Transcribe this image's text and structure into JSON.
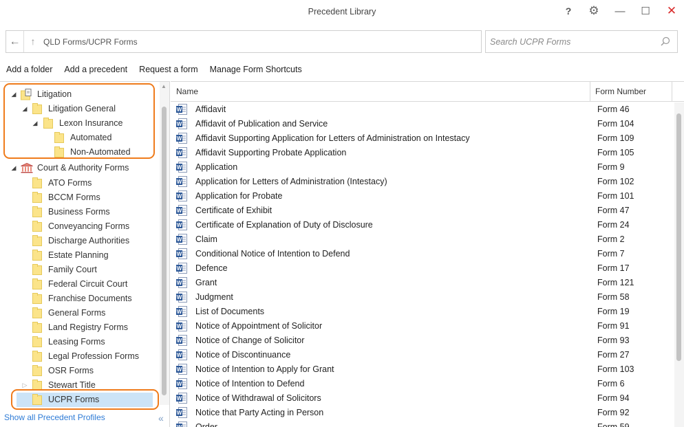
{
  "window": {
    "title": "Precedent Library",
    "help": "?",
    "gear": "⚙",
    "minimize": "—",
    "maximize": "☐",
    "close": "✕"
  },
  "address": {
    "back": "←",
    "up": "↑",
    "path": "QLD Forms/UCPR Forms"
  },
  "search": {
    "placeholder": "Search UCPR Forms"
  },
  "toolbar": {
    "add_folder": "Add a folder",
    "add_precedent": "Add a precedent",
    "request_form": "Request a form",
    "manage_shortcuts": "Manage Form Shortcuts"
  },
  "tree": {
    "litigation": "Litigation",
    "litigation_general": "Litigation General",
    "lexon_insurance": "Lexon Insurance",
    "automated": "Automated",
    "non_automated": "Non-Automated",
    "court_authority": "Court & Authority Forms",
    "folders": [
      "ATO Forms",
      "BCCM Forms",
      "Business Forms",
      "Conveyancing Forms",
      "Discharge Authorities",
      "Estate Planning",
      "Family Court",
      "Federal Circuit Court",
      "Franchise Documents",
      "General Forms",
      "Land Registry Forms",
      "Leasing Forms",
      "Legal Profession Forms",
      "OSR Forms",
      "Stewart Title",
      "UCPR Forms"
    ]
  },
  "left_footer": {
    "show_profiles": "Show all Precedent Profiles",
    "collapse": "«"
  },
  "columns": {
    "name": "Name",
    "form_number": "Form Number"
  },
  "forms": [
    {
      "name": "Affidavit",
      "number": "Form 46"
    },
    {
      "name": "Affidavit of Publication and Service",
      "number": "Form 104"
    },
    {
      "name": "Affidavit Supporting Application for Letters of Administration on Intestacy",
      "number": "Form 109"
    },
    {
      "name": "Affidavit Supporting Probate Application",
      "number": "Form 105"
    },
    {
      "name": "Application",
      "number": "Form 9"
    },
    {
      "name": "Application for Letters of Administration (Intestacy)",
      "number": "Form 102"
    },
    {
      "name": "Application for Probate",
      "number": "Form 101"
    },
    {
      "name": "Certificate of Exhibit",
      "number": "Form 47"
    },
    {
      "name": "Certificate of Explanation of Duty of Disclosure",
      "number": "Form 24"
    },
    {
      "name": "Claim",
      "number": "Form 2"
    },
    {
      "name": "Conditional Notice of Intention to Defend",
      "number": "Form 7"
    },
    {
      "name": "Defence",
      "number": "Form 17"
    },
    {
      "name": "Grant",
      "number": "Form 121"
    },
    {
      "name": "Judgment",
      "number": "Form 58"
    },
    {
      "name": "List of Documents",
      "number": "Form 19"
    },
    {
      "name": "Notice of Appointment of Solicitor",
      "number": "Form 91"
    },
    {
      "name": "Notice of Change of Solicitor",
      "number": "Form 93"
    },
    {
      "name": "Notice of Discontinuance",
      "number": "Form 27"
    },
    {
      "name": "Notice of Intention to Apply for Grant",
      "number": "Form 103"
    },
    {
      "name": "Notice of Intention to Defend",
      "number": "Form 6"
    },
    {
      "name": "Notice of Withdrawal of Solicitors",
      "number": "Form 94"
    },
    {
      "name": "Notice that Party Acting in Person",
      "number": "Form 92"
    },
    {
      "name": "Order",
      "number": "Form 59"
    }
  ],
  "colors": {
    "highlight": "#ef7b1b",
    "selection": "#cce4f7",
    "link": "#2e7bd6",
    "folder": "#fbe48a",
    "word_blue": "#2b5797"
  }
}
